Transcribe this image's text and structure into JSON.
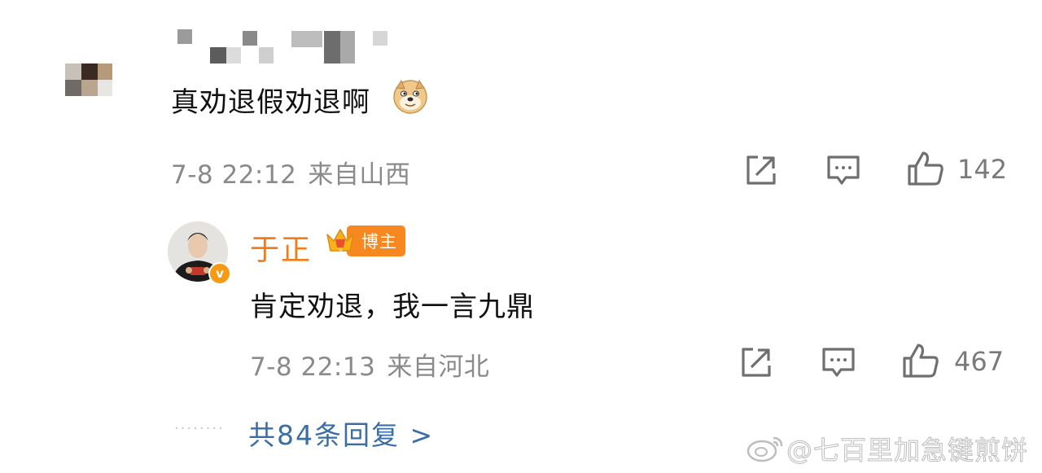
{
  "comment": {
    "text": "真劝退假劝退啊",
    "emoji": "doge",
    "date": "7-8 22:12",
    "location": "来自山西",
    "like_count": "142"
  },
  "reply": {
    "author": "于正",
    "badge_label": "博主",
    "text": "肯定劝退，我一言九鼎",
    "date": "7-8 22:13",
    "location": "来自河北",
    "like_count": "467"
  },
  "more_replies": {
    "label": "共84条回复 >"
  },
  "watermark": {
    "text": "@七百里加急键煎饼"
  },
  "colors": {
    "accent_orange": "#f07d1a",
    "link_blue": "#3b6ea5",
    "meta_gray": "#8a8a8a"
  },
  "icons": [
    "share-icon",
    "comment-icon",
    "like-icon",
    "doge-emoji",
    "crown-icon",
    "verified-badge-icon",
    "weibo-logo-icon"
  ]
}
